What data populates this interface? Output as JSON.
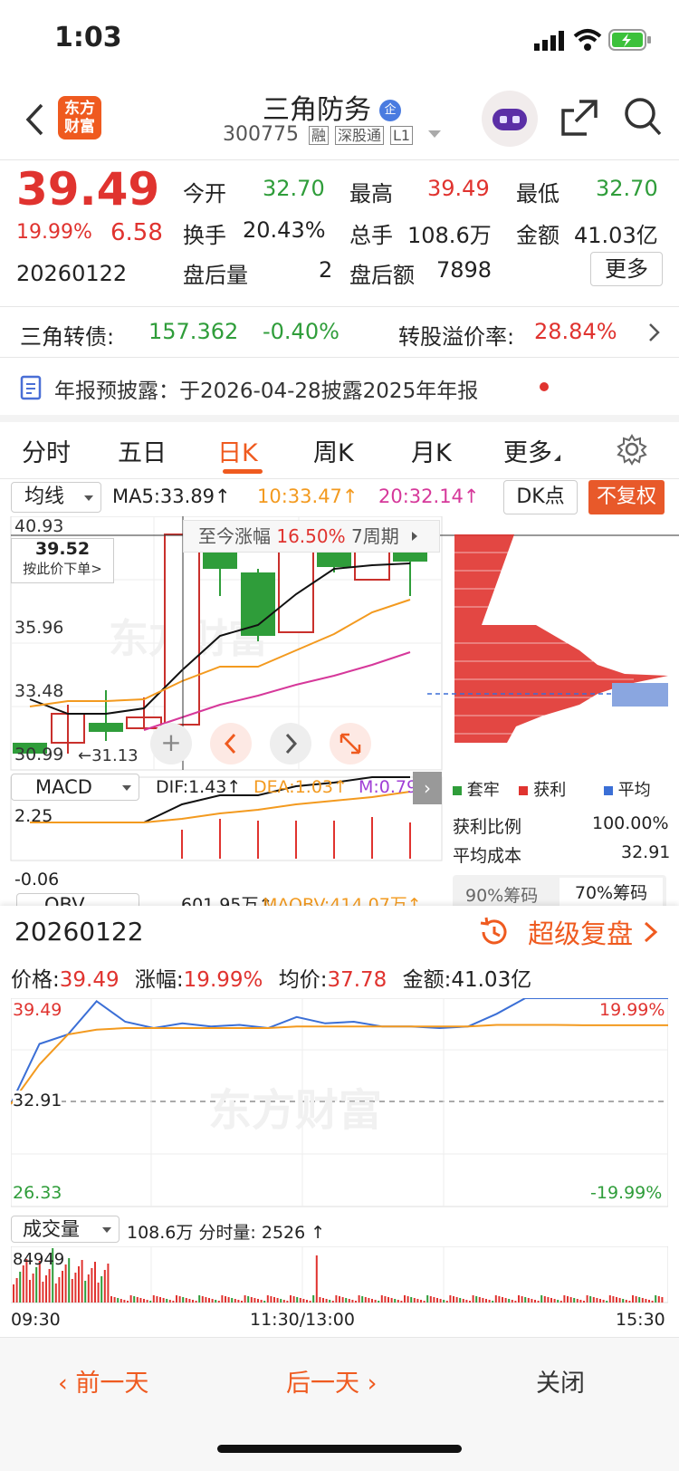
{
  "status_bar": {
    "time": "1:03"
  },
  "header": {
    "logo_text": "东方财富",
    "title": "三角防务",
    "title_badge": "企",
    "code": "300775",
    "tags": [
      "融",
      "深股通",
      "L1"
    ]
  },
  "quote": {
    "price": "39.49",
    "change_pct": "19.99%",
    "change_abs": "6.58",
    "date": "20260122",
    "fields": [
      {
        "label": "今开",
        "value": "32.70",
        "color": "green"
      },
      {
        "label": "最高",
        "value": "39.49",
        "color": "red"
      },
      {
        "label": "最低",
        "value": "32.70",
        "color": "green"
      },
      {
        "label": "换手",
        "value": "20.43%",
        "color": "black"
      },
      {
        "label": "总手",
        "value": "108.6万",
        "color": "black"
      },
      {
        "label": "金额",
        "value": "41.03亿",
        "color": "black"
      },
      {
        "label": "盘后量",
        "value": "2",
        "color": "black"
      },
      {
        "label": "盘后额",
        "value": "7898",
        "color": "black"
      }
    ],
    "more_label": "更多"
  },
  "bond": {
    "label": "三角转债:",
    "price": "157.362",
    "change": "-0.40%",
    "premium_label": "转股溢价率:",
    "premium_value": "28.84%"
  },
  "notice": {
    "text": "年报预披露：于2026-04-28披露2025年年报"
  },
  "tabs": [
    "分时",
    "五日",
    "日K",
    "周K",
    "月K",
    "更多"
  ],
  "active_tab": "日K",
  "kline": {
    "indicator_select": "均线",
    "ma5": "MA5:33.89↑",
    "ma10": "10:33.47↑",
    "ma20": "20:32.14↑",
    "dk_label": "DK点",
    "fq_label": "不复权",
    "y_labels": [
      "40.93",
      "35.96",
      "33.48",
      "30.99"
    ],
    "low_marker": "31.13",
    "cursor_price": "39.52",
    "cursor_hint": "按此价下单>",
    "range_tip_label": "至今涨幅",
    "range_tip_value": "16.50%",
    "range_tip_period": "7周期",
    "cost_marker": "32.91"
  },
  "chips": {
    "legend": [
      "套牢",
      "获利",
      "平均"
    ],
    "profit_ratio_label": "获利比例",
    "profit_ratio_value": "100.00%",
    "avg_cost_label": "平均成本",
    "avg_cost_value": "32.91",
    "tab_90": "90%筹码",
    "tab_70": "70%筹码"
  },
  "macd": {
    "select": "MACD",
    "dif": "DIF:1.43↑",
    "dea": "DEA:1.03↑",
    "m": "M:0.79↑",
    "y_top": "2.25",
    "y_bottom": "-0.06"
  },
  "obv": {
    "select": "OBV",
    "value1": "601.95万↑",
    "value2": "MAOBV:414.07万↑"
  },
  "popup": {
    "date": "20260122",
    "review_label": "超级复盘",
    "price_label": "价格:",
    "price_value": "39.49",
    "pct_label": "涨幅:",
    "pct_value": "19.99%",
    "avg_label": "均价:",
    "avg_value": "37.78",
    "amount_label": "金额:",
    "amount_value": "41.03亿",
    "y_top": "39.49",
    "y_mid": "32.91",
    "y_bottom": "26.33",
    "pct_top": "19.99%",
    "pct_bottom": "-19.99%",
    "vol_select": "成交量",
    "vol_info": "108.6万 分时量: 2526 ↑",
    "vol_max": "84949",
    "time_labels": [
      "09:30",
      "11:30/13:00",
      "15:30"
    ],
    "prev_day": "前一天",
    "next_day": "后一天",
    "close": "关闭"
  },
  "chart_data": {
    "type": "line",
    "title": "",
    "ylim": [
      26.33,
      39.49
    ],
    "series": [
      {
        "name": "价格",
        "values": [
          32.8,
          36.6,
          37.2,
          39.3,
          38.0,
          37.6,
          37.9,
          37.7,
          37.8,
          37.6,
          38.3,
          37.9,
          38.0,
          37.7,
          37.7,
          37.6,
          37.7,
          38.5,
          39.49,
          39.49,
          39.49,
          39.49,
          39.49,
          39.49
        ]
      },
      {
        "name": "均价",
        "values": [
          32.8,
          35.3,
          37.2,
          37.5,
          37.6,
          37.6,
          37.6,
          37.6,
          37.6,
          37.6,
          37.7,
          37.7,
          37.7,
          37.7,
          37.7,
          37.7,
          37.7,
          37.8,
          37.8,
          37.8,
          37.78,
          37.78,
          37.78,
          37.78
        ]
      }
    ]
  }
}
